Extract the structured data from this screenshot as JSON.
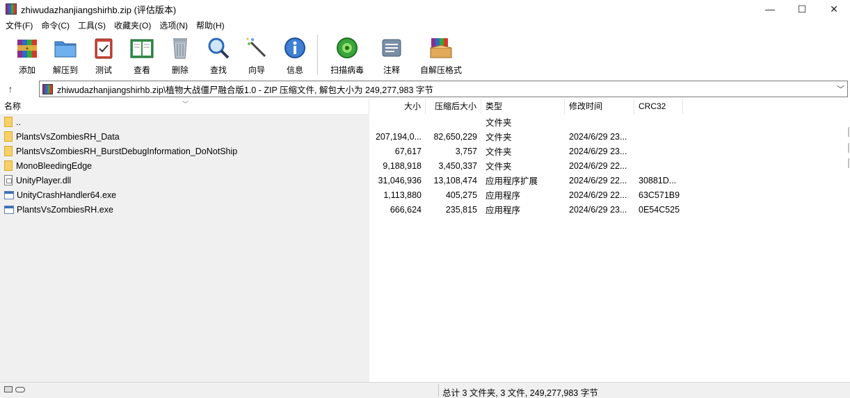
{
  "window": {
    "title": "zhiwudazhanjiangshirhb.zip (评估版本)",
    "controls": {
      "minimize": "—",
      "maximize": "☐",
      "close": "✕"
    }
  },
  "menu": [
    "文件(F)",
    "命令(C)",
    "工具(S)",
    "收藏夹(O)",
    "选项(N)",
    "帮助(H)"
  ],
  "toolbar": {
    "add": "添加",
    "extract_to": "解压到",
    "test": "测试",
    "view": "查看",
    "delete": "删除",
    "find": "查找",
    "wizard": "向导",
    "info": "信息",
    "virus_scan": "扫描病毒",
    "comment": "注释",
    "sfx": "自解压格式"
  },
  "address": {
    "up_icon": "↑",
    "path": "zhiwudazhanjiangshirhb.zip\\植物大战僵尸融合版1.0 - ZIP 压缩文件, 解包大小为 249,277,983 字节",
    "dropdown_icon": "﹀"
  },
  "columns": {
    "name": "名称",
    "size": "大小",
    "packed": "压缩后大小",
    "type": "类型",
    "modified": "修改时间",
    "crc": "CRC32"
  },
  "files": [
    {
      "icon": "folder",
      "name": "..",
      "size": "",
      "packed": "",
      "type": "文件夹",
      "modified": "",
      "crc": ""
    },
    {
      "icon": "folder",
      "name": "PlantsVsZombiesRH_Data",
      "size": "207,194,0...",
      "packed": "82,650,229",
      "type": "文件夹",
      "modified": "2024/6/29 23...",
      "crc": ""
    },
    {
      "icon": "folder",
      "name": "PlantsVsZombiesRH_BurstDebugInformation_DoNotShip",
      "size": "67,617",
      "packed": "3,757",
      "type": "文件夹",
      "modified": "2024/6/29 23...",
      "crc": ""
    },
    {
      "icon": "folder",
      "name": "MonoBleedingEdge",
      "size": "9,188,918",
      "packed": "3,450,337",
      "type": "文件夹",
      "modified": "2024/6/29 22...",
      "crc": ""
    },
    {
      "icon": "dll",
      "name": "UnityPlayer.dll",
      "size": "31,046,936",
      "packed": "13,108,474",
      "type": "应用程序扩展",
      "modified": "2024/6/29 22...",
      "crc": "30881D..."
    },
    {
      "icon": "exe",
      "name": "UnityCrashHandler64.exe",
      "size": "1,113,880",
      "packed": "405,275",
      "type": "应用程序",
      "modified": "2024/6/29 22...",
      "crc": "63C571B9"
    },
    {
      "icon": "exe",
      "name": "PlantsVsZombiesRH.exe",
      "size": "666,624",
      "packed": "235,815",
      "type": "应用程序",
      "modified": "2024/6/29 23...",
      "crc": "0E54C525"
    }
  ],
  "status": {
    "summary": "总计 3 文件夹, 3 文件, 249,277,983 字节"
  }
}
